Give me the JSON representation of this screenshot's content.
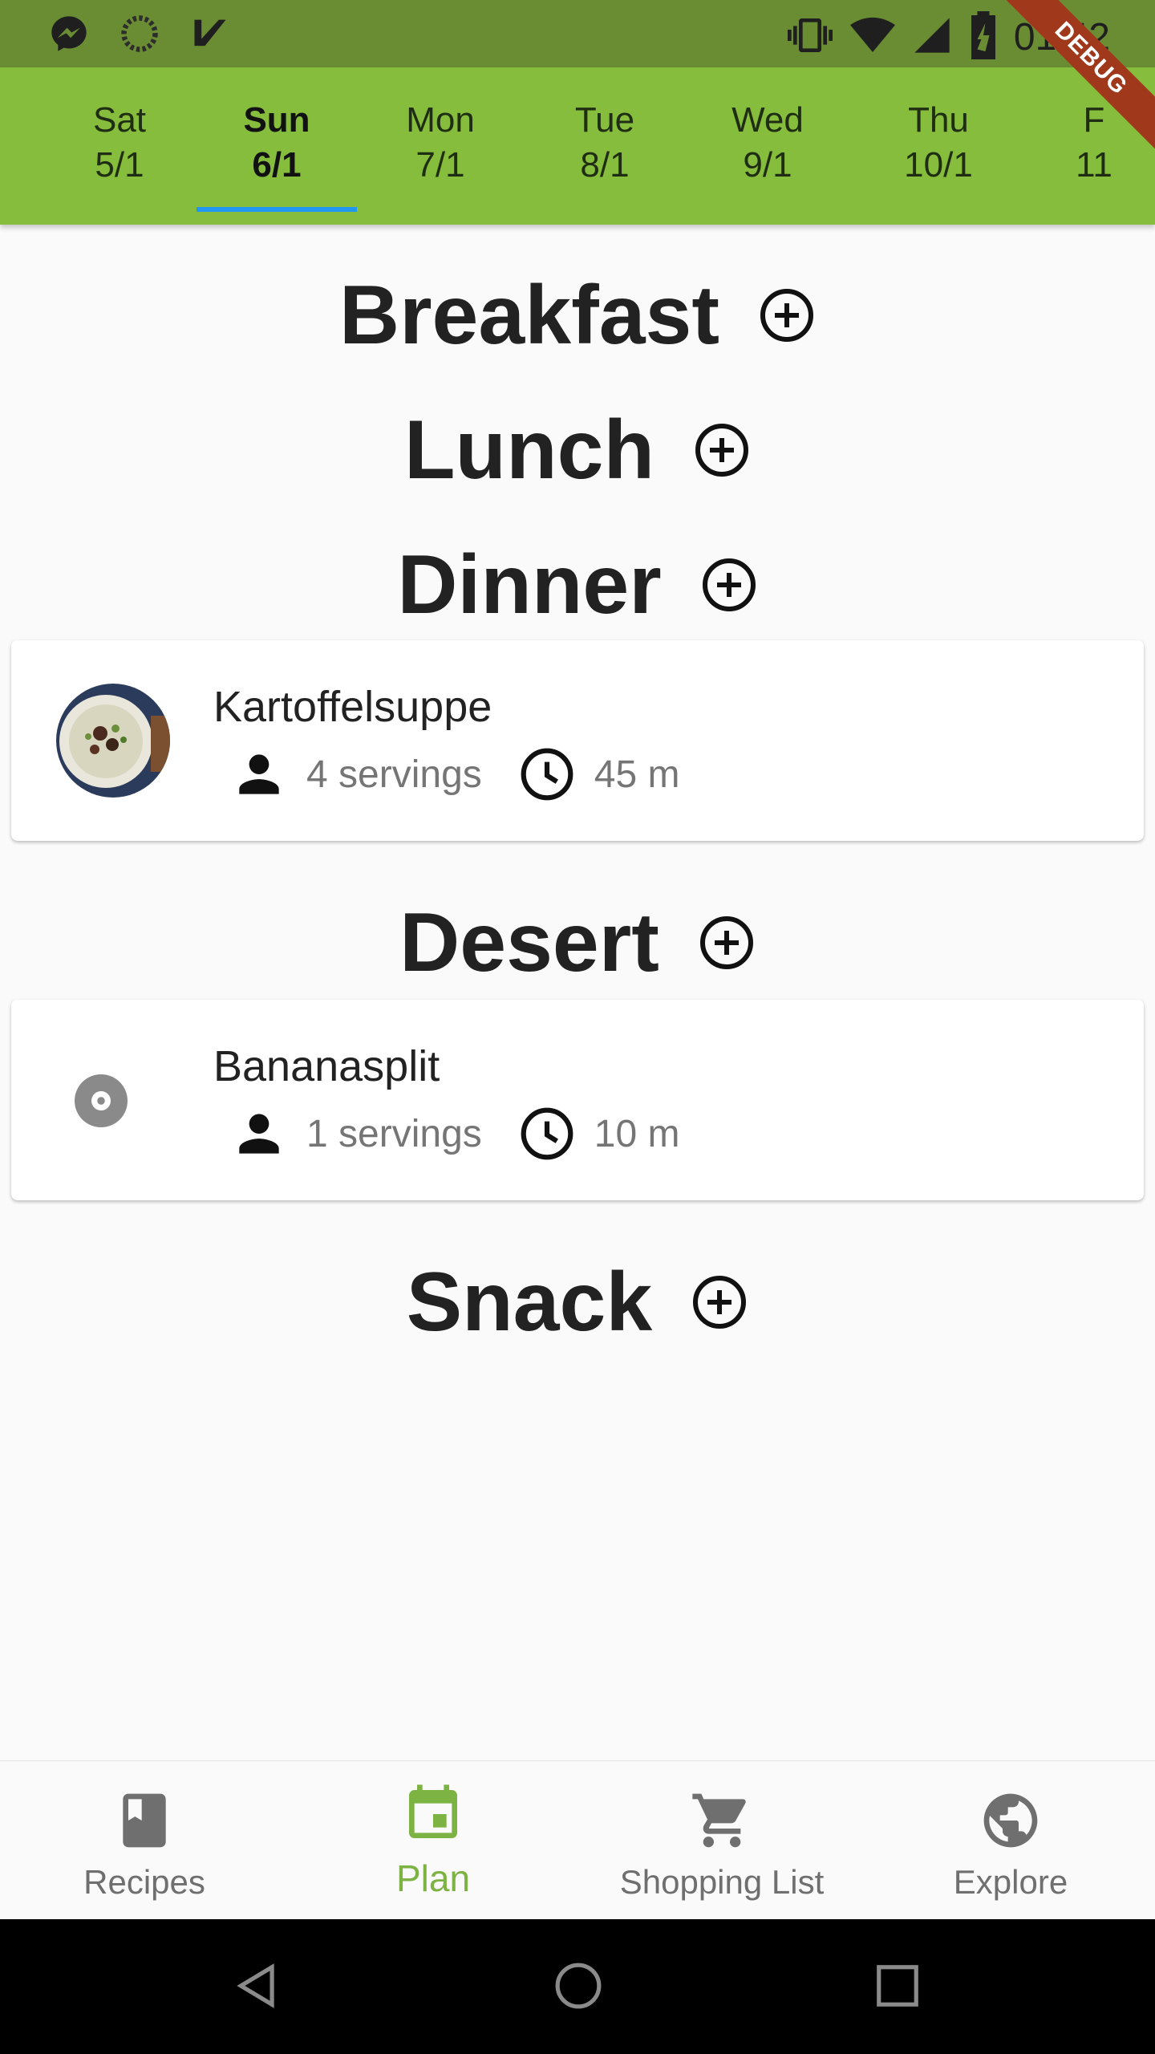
{
  "status_bar": {
    "time": "01:42",
    "left_icons": [
      "messenger-icon",
      "circle-icon",
      "checkmark-icon"
    ],
    "right_icons": [
      "vibrate-icon",
      "wifi-icon",
      "signal-icon",
      "battery-icon"
    ]
  },
  "debug_label": "DEBUG",
  "date_tabs": [
    {
      "day": "Sat",
      "date": "5/1"
    },
    {
      "day": "Sun",
      "date": "6/1",
      "active": true
    },
    {
      "day": "Mon",
      "date": "7/1"
    },
    {
      "day": "Tue",
      "date": "8/1"
    },
    {
      "day": "Wed",
      "date": "9/1"
    },
    {
      "day": "Thu",
      "date": "10/1"
    },
    {
      "day": "F",
      "date": "11"
    }
  ],
  "meals": {
    "breakfast": {
      "title": "Breakfast"
    },
    "lunch": {
      "title": "Lunch"
    },
    "dinner": {
      "title": "Dinner",
      "recipe": {
        "name": "Kartoffelsuppe",
        "servings": "4 servings",
        "time": "45 m"
      }
    },
    "desert": {
      "title": "Desert",
      "recipe": {
        "name": "Bananasplit",
        "servings": "1 servings",
        "time": "10 m"
      }
    },
    "snack": {
      "title": "Snack"
    }
  },
  "bottom_nav": {
    "items": [
      {
        "label": "Recipes",
        "icon": "book-icon"
      },
      {
        "label": "Plan",
        "icon": "calendar-icon",
        "active": true
      },
      {
        "label": "Shopping List",
        "icon": "cart-icon"
      },
      {
        "label": "Explore",
        "icon": "globe-icon"
      }
    ]
  },
  "colors": {
    "app_bar": "#86bd3c",
    "status_bar": "#6a8d33",
    "active_nav": "#7cb342",
    "tab_indicator": "#2196f3"
  }
}
